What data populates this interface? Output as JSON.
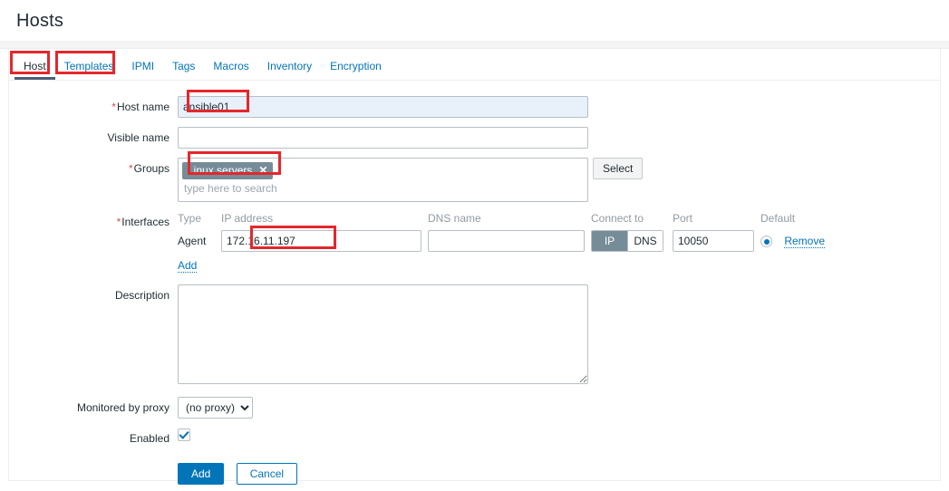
{
  "page": {
    "title": "Hosts"
  },
  "tabs": [
    {
      "label": "Host",
      "active": true
    },
    {
      "label": "Templates",
      "active": false
    },
    {
      "label": "IPMI",
      "active": false
    },
    {
      "label": "Tags",
      "active": false
    },
    {
      "label": "Macros",
      "active": false
    },
    {
      "label": "Inventory",
      "active": false
    },
    {
      "label": "Encryption",
      "active": false
    }
  ],
  "form": {
    "host_name": {
      "label": "Host name",
      "required_marker": "*",
      "value": "ansible01"
    },
    "visible_name": {
      "label": "Visible name",
      "value": ""
    },
    "groups": {
      "label": "Groups",
      "required_marker": "*",
      "chips": [
        {
          "label": "Linux servers",
          "remove_icon": "close-x"
        }
      ],
      "search_placeholder": "type here to search",
      "select_button": "Select"
    },
    "interfaces": {
      "label": "Interfaces",
      "required_marker": "*",
      "columns": [
        "Type",
        "IP address",
        "DNS name",
        "Connect to",
        "Port",
        "Default"
      ],
      "rows": [
        {
          "type": "Agent",
          "ip": "172.16.11.197",
          "dns": "",
          "connect_to": {
            "options": [
              "IP",
              "DNS"
            ],
            "selected": "IP"
          },
          "port": "10050",
          "default_selected": true,
          "remove_label": "Remove"
        }
      ],
      "add_label": "Add"
    },
    "description": {
      "label": "Description",
      "value": ""
    },
    "proxy": {
      "label": "Monitored by proxy",
      "selected": "(no proxy)",
      "options": [
        "(no proxy)"
      ]
    },
    "enabled": {
      "label": "Enabled",
      "checked": true
    },
    "actions": {
      "submit": "Add",
      "cancel": "Cancel"
    }
  },
  "colors": {
    "link": "#0275b8",
    "primary": "#0275b8",
    "chip_bg": "#768d99",
    "required": "#d65050",
    "annotation": "#e4272c",
    "focused_input_bg": "#e8f0fa"
  }
}
